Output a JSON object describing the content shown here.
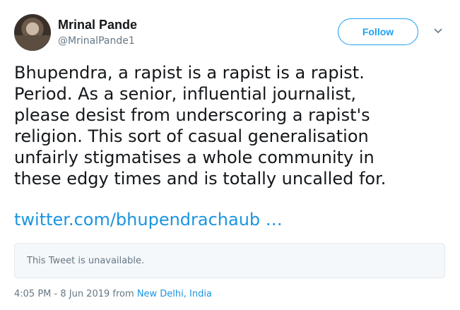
{
  "author": {
    "name": "Mrinal Pande",
    "handle": "@MrinalPande1",
    "avatar_icon": "profile-photo-avatar"
  },
  "actions": {
    "follow_label": "Follow",
    "menu_icon": "chevron-down-icon"
  },
  "tweet": {
    "lines": [
      "Bhupendra, a rapist is a rapist is a rapist.",
      "Period. As a senior, influential journalist,",
      "please desist from underscoring a rapist's",
      "religion. This sort of casual  generalisation",
      "unfairly stigmatises a whole community in",
      "these edgy times and is totally uncalled for."
    ],
    "link_text": "twitter.com/bhupendrachaub …"
  },
  "quoted": {
    "unavailable_text": "This Tweet is unavailable."
  },
  "meta": {
    "timestamp": "4:05 PM - 8 Jun 2019",
    "from_word": " from ",
    "location": "New Delhi, India"
  },
  "colors": {
    "accent": "#1da1f2",
    "link": "#1b95e0",
    "text": "#14171a",
    "secondary": "#657786",
    "card_bg": "#f5f8fa",
    "card_border": "#e1e8ed"
  }
}
